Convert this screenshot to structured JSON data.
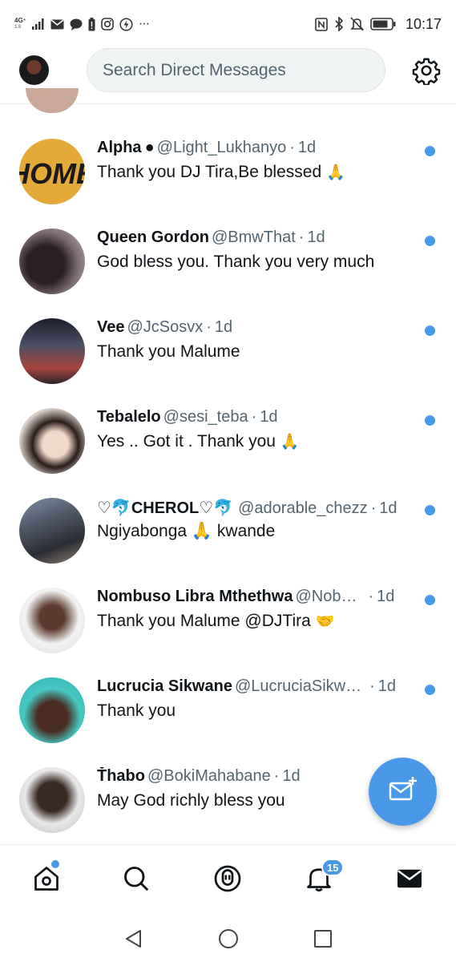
{
  "status_bar": {
    "network_label": "4G⁺",
    "network_sub": "1.6",
    "time": "10:17",
    "overflow": "···",
    "icons": [
      "signal-icon",
      "mail-icon",
      "chat-icon",
      "battery-alert-icon",
      "instagram-icon",
      "data-saver-icon",
      "nfc-icon",
      "bluetooth-icon",
      "mute-icon",
      "battery-icon"
    ]
  },
  "header": {
    "search_placeholder": "Search Direct Messages",
    "settings_icon": "gear-icon"
  },
  "conversations": [
    {
      "name": "Alpha",
      "name_suffix": "●",
      "handle": "@Light_Lukhanyo",
      "time": "1d",
      "message": "Thank you DJ Tira,Be blessed",
      "emoji": "🙏",
      "unread": true
    },
    {
      "name": "Queen Gordon",
      "name_suffix": "",
      "handle": "@BmwThat",
      "time": "1d",
      "message": "God bless you. Thank you very much",
      "emoji": "",
      "unread": true
    },
    {
      "name": "Vee",
      "name_suffix": "",
      "handle": "@JcSosvx",
      "time": "1d",
      "message": "Thank you Malume",
      "emoji": "",
      "unread": true
    },
    {
      "name": "Tebalelo",
      "name_suffix": "",
      "handle": "@sesi_teba",
      "time": "1d",
      "message": "Yes .. Got it . Thank you",
      "emoji": "🙏",
      "unread": true
    },
    {
      "name": "♡🐬CHEROL♡🐬",
      "name_suffix": "",
      "handle": "@adorable_chezz",
      "time": "1d",
      "message": "Ngiyabonga 🙏 kwande",
      "emoji": "",
      "unread": true
    },
    {
      "name": "Nombuso Libra Mthethwa",
      "name_suffix": "",
      "handle": "@Nob…",
      "time": "1d",
      "message": "Thank you Malume @DJTira",
      "emoji": "🤝",
      "unread": true
    },
    {
      "name": "Lucrucia Sikwane",
      "name_suffix": "",
      "handle": "@LucruciaSikw…",
      "time": "1d",
      "message": "Thank you",
      "emoji": "",
      "unread": true
    },
    {
      "name": "Ťhabo",
      "name_suffix": "",
      "handle": "@BokiMahabane",
      "time": "1d",
      "message": "May God richly bless you",
      "emoji": "",
      "unread": true
    }
  ],
  "separator": "·",
  "fab": {
    "icon": "new-message-icon"
  },
  "bottom_nav": {
    "items": [
      "home-icon",
      "search-icon",
      "spaces-icon",
      "notifications-icon",
      "messages-icon"
    ],
    "notification_count": "15",
    "home_has_dot": true
  },
  "system_nav": [
    "back-icon",
    "home-circle-icon",
    "recents-icon"
  ],
  "colors": {
    "accent": "#4a99e9",
    "text": "#0f1419",
    "secondary": "#536471"
  }
}
